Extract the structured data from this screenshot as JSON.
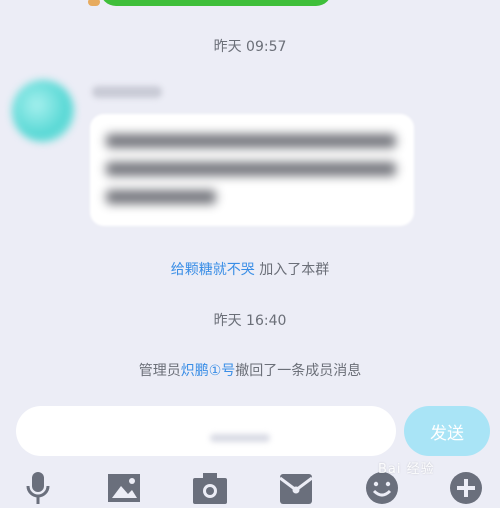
{
  "chat": {
    "timestamp_1": "昨天 09:57",
    "timestamp_2": "昨天 16:40",
    "join_notice": {
      "name": "给颗糖就不哭",
      "text": " 加入了本群"
    },
    "recall_notice": {
      "prefix": "管理员",
      "name": "炽鹏①号",
      "suffix": "撤回了一条成员消息"
    }
  },
  "input_bar": {
    "send_label": "发送"
  },
  "toolbar": {
    "icons": [
      "microphone-icon",
      "image-icon",
      "camera-icon",
      "red-packet-icon",
      "emoji-icon",
      "plus-icon"
    ]
  },
  "colors": {
    "background": "#ecedf6",
    "link": "#3a8ee6",
    "send_button": "#a9e4f6",
    "icon": "#6a6f7c"
  },
  "watermark": "Bai 经验"
}
